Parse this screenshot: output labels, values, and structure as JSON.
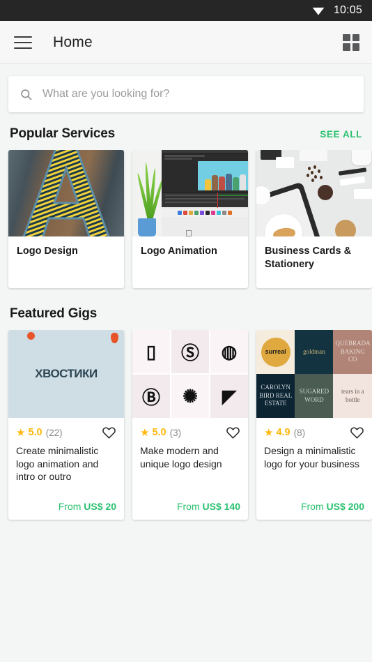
{
  "statusbar": {
    "time": "10:05",
    "wifi_icon": "wifi-icon"
  },
  "appbar": {
    "menu_icon": "hamburger-menu-icon",
    "title": "Home",
    "grid_icon": "grid-view-icon"
  },
  "search": {
    "icon": "search-icon",
    "placeholder": "What are you looking for?",
    "value": ""
  },
  "popular_services": {
    "title": "Popular Services",
    "see_all_label": "SEE ALL",
    "accent_color": "#29c16f",
    "cards": [
      {
        "label": "Logo Design",
        "image": "striped-letter-a-signage-photo"
      },
      {
        "label": "Logo Animation",
        "image": "imac-video-editing-workspace-photo"
      },
      {
        "label": "Business Cards & Stationery",
        "image": "stationery-flatlay-photo"
      }
    ]
  },
  "featured_gigs": {
    "title": "Featured Gigs",
    "star_color": "#ffb80b",
    "price_color": "#29c16f",
    "cards": [
      {
        "image": "khvostiki-logo-animation-thumbnail",
        "brand_text": "ХВОСТИКИ",
        "star_icon": "star-icon",
        "rating": "5.0",
        "reviews": "(22)",
        "favorite_icon": "heart-outline-icon",
        "title": "Create minimalistic logo animation and intro or outro",
        "price_prefix": "From",
        "price": "US$ 20"
      },
      {
        "image": "black-and-white-logo-grid-thumbnail",
        "star_icon": "star-icon",
        "rating": "5.0",
        "reviews": "(3)",
        "favorite_icon": "heart-outline-icon",
        "title": "Make modern and unique logo design",
        "price_prefix": "From",
        "price": "US$ 140",
        "logo_cells": [
          "▯",
          "Ⓢ",
          "◍",
          "Ⓑ",
          "✺",
          "◤"
        ]
      },
      {
        "image": "brand-identity-color-grid-thumbnail",
        "star_icon": "star-icon",
        "rating": "4.9",
        "reviews": "(8)",
        "favorite_icon": "heart-outline-icon",
        "title": "Design a minimalistic logo for your business",
        "price_prefix": "From",
        "price": "US$ 200",
        "brand_cells": [
          "surreal",
          "goldman",
          "QUEBRADA BAKING CO",
          "CAROLYN BIRD REAL ESTATE",
          "SUGARED WORD",
          "tears in a bottle"
        ]
      }
    ]
  }
}
